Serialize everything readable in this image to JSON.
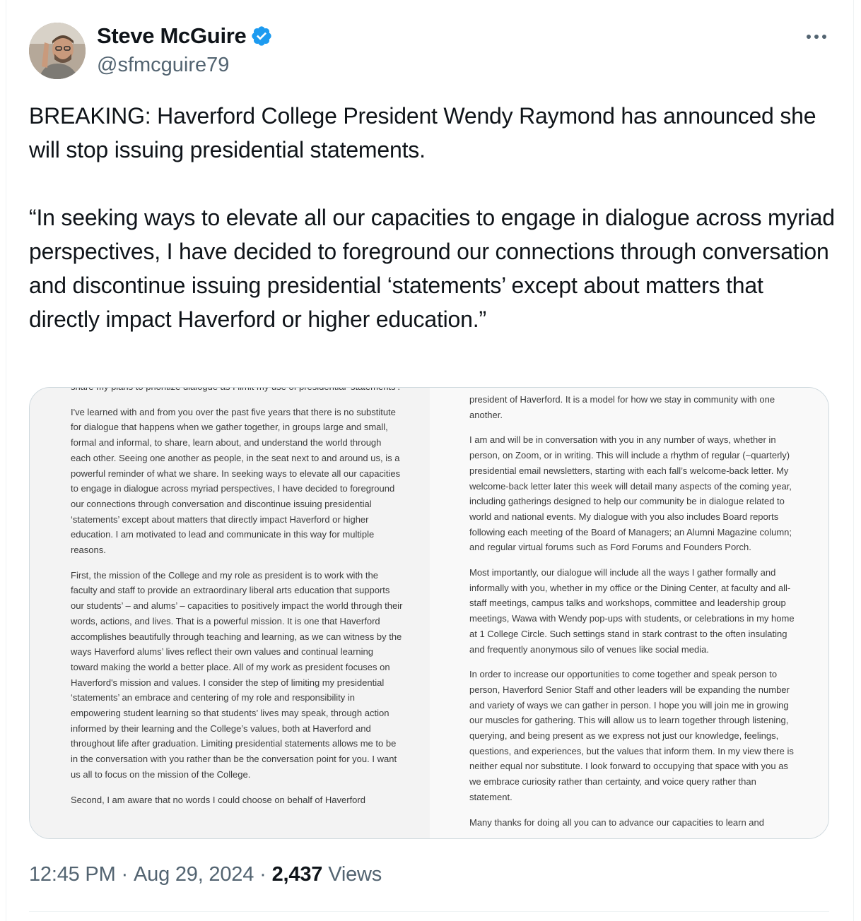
{
  "author": {
    "display_name": "Steve McGuire",
    "handle": "@sfmcguire79",
    "verified": true
  },
  "more_icon": "more-horizontal-icon",
  "tweet": {
    "paragraphs": [
      "BREAKING: Haverford College President Wendy Raymond has announced she will stop issuing presidential statements.",
      "“In seeking ways to elevate all our capacities to engage in dialogue across myriad perspectives, I have decided to foreground our connections through conversation and discontinue issuing presidential ‘statements’ except about matters that directly impact Haverford or higher education.”"
    ]
  },
  "media": {
    "left_column": [
      "share my plans to prioritize dialogue as I limit my use of presidential ‘statements’.",
      "I've learned with and from you over the past five years that there is no substitute for dialogue that happens when we gather together, in groups large and small, formal and informal, to share, learn about, and understand the world through each other. Seeing one another as people, in the seat next to and around us, is a powerful reminder of what we share. In seeking ways to elevate all our capacities to engage in dialogue across myriad perspectives, I have decided to foreground our connections through conversation and discontinue issuing presidential ‘statements’ except about matters that directly impact Haverford or higher education. I am motivated to lead and communicate in this way for multiple reasons.",
      "First, the mission of the College and my role as president is to work with the faculty and staff to provide an extraordinary liberal arts education that supports our students’ – and alums’ – capacities to positively impact the world through their words, actions, and lives. That is a powerful mission. It is one that Haverford accomplishes beautifully through teaching and learning, as we can witness by the ways Haverford alums’ lives reflect their own values and continual learning toward making the world a better place. All of my work as president focuses on Haverford's mission and values. I consider the step of limiting my presidential ‘statements’ an embrace and centering of my role and responsibility in empowering student learning so that students’ lives may speak, through action informed by their learning and the College’s values, both at Haverford and throughout life after graduation. Limiting presidential statements allows me to be in the conversation with you rather than be the conversation point for you. I want us all to focus on the mission of the College.",
      "Second, I am aware that no words I could choose on behalf of Haverford"
    ],
    "right_column": [
      "president of Haverford. It is a model for how we stay in community with one another.",
      "I am and will be in conversation with you in any number of ways, whether in person, on Zoom, or in writing. This will include a rhythm of regular (~quarterly) presidential email newsletters, starting with each fall’s welcome-back letter. My welcome-back letter later this week will detail many aspects of the coming year, including gatherings designed to help our community be in dialogue related to world and national events. My dialogue with you also includes Board reports following each meeting of the Board of Managers; an Alumni Magazine column; and regular virtual forums such as Ford Forums and Founders Porch.",
      "Most importantly, our dialogue will include all the ways I gather formally and informally with you, whether in my office or the Dining Center, at faculty and all-staff meetings, campus talks and workshops, committee and leadership group meetings, Wawa with Wendy pop-ups with students, or celebrations in my home at 1 College Circle. Such settings stand in stark contrast to the often insulating and frequently anonymous silo of venues like social media.",
      "In order to increase our opportunities to come together and speak person to person, Haverford Senior Staff and other leaders will be expanding the number and variety of ways we can gather in person. I hope you will join me in growing our muscles for gathering. This will allow us to learn together through listening, querying, and being present as we express not just our knowledge, feelings, questions, and experiences, but the values that inform them. In my view there is neither equal nor substitute. I look forward to occupying that space with you as we embrace curiosity rather than certainty, and voice query rather than statement.",
      "Many thanks for doing all you can to advance our capacities to learn and"
    ]
  },
  "meta": {
    "time": "12:45 PM",
    "date": "Aug 29, 2024",
    "separator": "·",
    "views_count": "2,437",
    "views_label": "Views"
  },
  "colors": {
    "text_primary": "#0f1419",
    "text_secondary": "#536471",
    "verified_blue": "#1d9bf0",
    "border": "#cfd9de"
  }
}
